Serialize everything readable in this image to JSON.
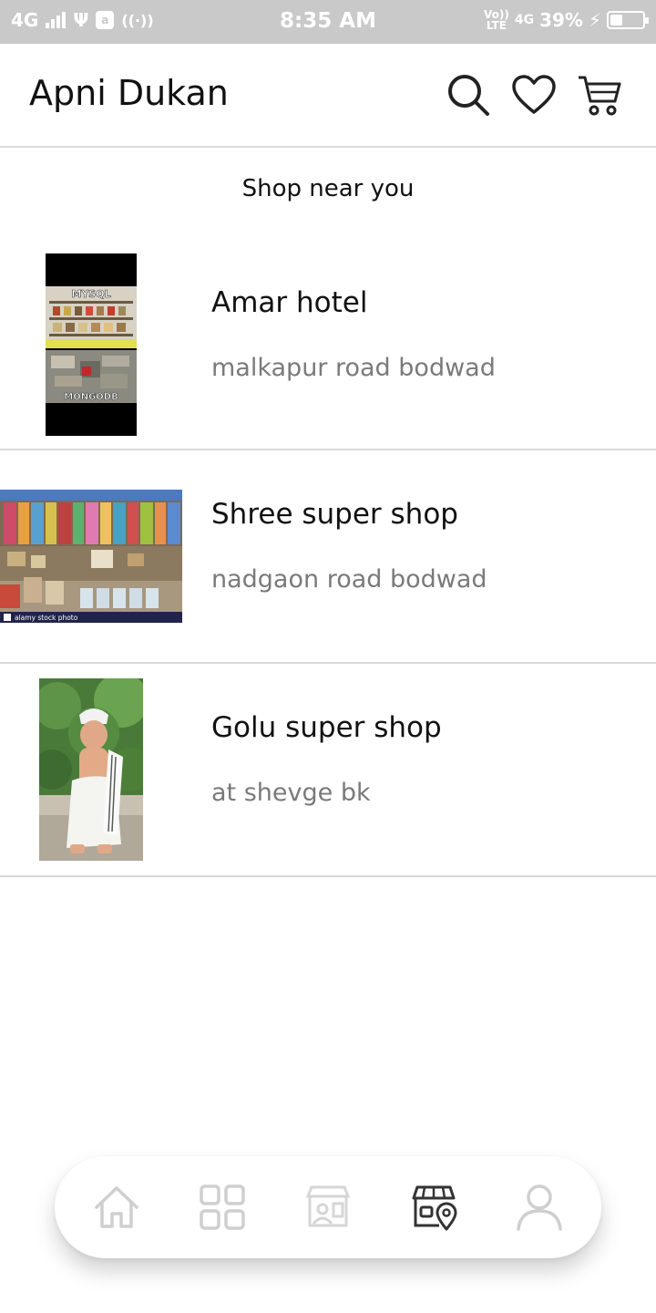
{
  "status_bar": {
    "network": "4G",
    "time": "8:35 AM",
    "volte": "Vo))",
    "lte": "LTE",
    "network_right": "4G",
    "battery_percent": "39%",
    "battery_level": 0.39,
    "usb_label": "Ψ",
    "app_badge": "a"
  },
  "app_bar": {
    "title": "Apni Dukan",
    "actions": [
      "search-icon",
      "heart-icon",
      "cart-icon"
    ]
  },
  "section": {
    "title": "Shop near you"
  },
  "shops": [
    {
      "name": "Amar hotel",
      "address": "malkapur road bodwad",
      "image_top_label": "MYSQL",
      "image_bottom_label": "MONGODB"
    },
    {
      "name": "Shree super shop",
      "address": "nadgaon road bodwad",
      "image_caption": "alamy stock photo"
    },
    {
      "name": "Golu super shop",
      "address": "at shevge bk"
    }
  ],
  "bottom_nav": {
    "items": [
      "home-icon",
      "grid-icon",
      "shop-person-icon",
      "store-location-icon",
      "profile-icon"
    ],
    "active": "store-location-icon"
  },
  "colors": {
    "status_bar_bg": "#c9c9c9",
    "divider": "#d8d8d8",
    "address_text": "#7a7a7a",
    "nav_inactive": "#cfcfcf",
    "nav_active": "#333333"
  }
}
